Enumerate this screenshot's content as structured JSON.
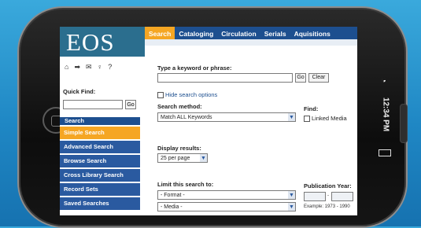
{
  "device": {
    "status_time": "12:34 PM"
  },
  "app": {
    "logo_text": "EOS"
  },
  "top_tabs": [
    {
      "label": "Search",
      "active": true
    },
    {
      "label": "Cataloging",
      "active": false
    },
    {
      "label": "Circulation",
      "active": false
    },
    {
      "label": "Serials",
      "active": false
    },
    {
      "label": "Aquisitions",
      "active": false
    }
  ],
  "sidebar": {
    "nav_icons": [
      "home-icon",
      "forward-icon",
      "mail-icon",
      "user-icon",
      "help-icon"
    ],
    "nav_glyphs": [
      "⌂",
      "➡",
      "✉",
      "♀",
      "?"
    ],
    "quick_find_label": "Quick Find:",
    "quick_go": "Go",
    "menu_header": "Search",
    "items": [
      {
        "label": "Simple Search",
        "active": true
      },
      {
        "label": "Advanced Search",
        "active": false
      },
      {
        "label": "Browse Search",
        "active": false
      },
      {
        "label": "Cross Library Search",
        "active": false
      },
      {
        "label": "Record Sets",
        "active": false
      },
      {
        "label": "Saved Searches",
        "active": false
      }
    ]
  },
  "search": {
    "keyword_label": "Type a keyword or phrase:",
    "go_label": "Go",
    "clear_label": "Clear",
    "hide_options": "Hide search options",
    "method_label": "Search method:",
    "method_value": "Match ALL Keywords",
    "find_label": "Find:",
    "linked_media_label": "Linked Media",
    "display_label": "Display results:",
    "display_value": "25 per page",
    "limit_label": "Limit this search to:",
    "format_value": "- Format -",
    "media_value": "- Media -",
    "pub_year_label": "Publication Year:",
    "pub_year_example": "Example: 1973 - 1990"
  },
  "colors": {
    "nav_blue": "#1d4f8f",
    "accent_orange": "#f5a623",
    "logo_teal": "#2b6e8e"
  }
}
